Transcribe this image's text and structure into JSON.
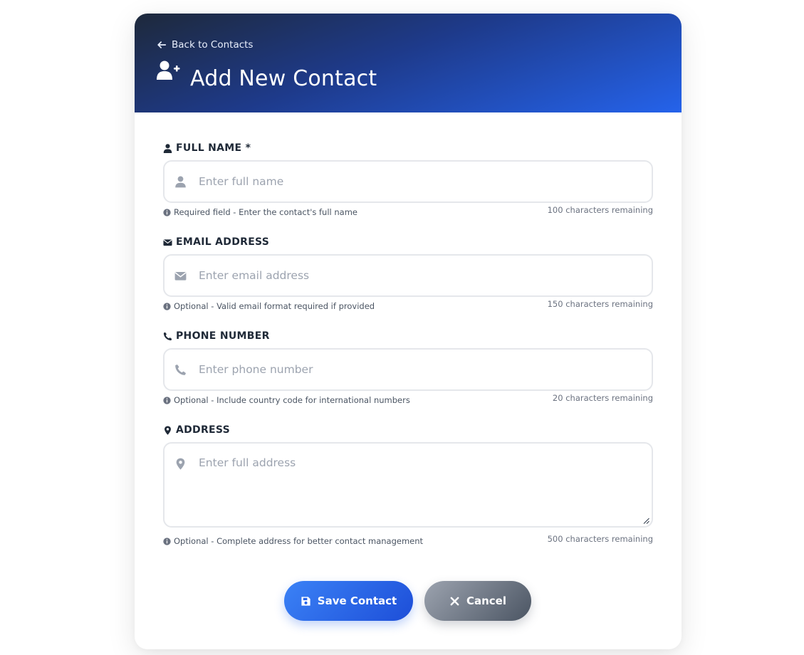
{
  "header": {
    "back_label": "Back to Contacts",
    "title": "Add New Contact"
  },
  "form": {
    "full_name": {
      "label": "FULL NAME *",
      "placeholder": "Enter full name",
      "value": "",
      "hint": "Required field - Enter the contact's full name",
      "counter": "100 characters remaining",
      "icon": "user-icon"
    },
    "email": {
      "label": "EMAIL ADDRESS",
      "placeholder": "Enter email address",
      "value": "",
      "hint": "Optional - Valid email format required if provided",
      "counter": "150 characters remaining",
      "icon": "envelope-icon"
    },
    "phone": {
      "label": "PHONE NUMBER",
      "placeholder": "Enter phone number",
      "value": "",
      "hint": "Optional - Include country code for international numbers",
      "counter": "20 characters remaining",
      "icon": "phone-icon"
    },
    "address": {
      "label": "ADDRESS",
      "placeholder": "Enter full address",
      "value": "",
      "hint": "Optional - Complete address for better contact management",
      "counter": "500 characters remaining",
      "icon": "map-marker-icon"
    }
  },
  "actions": {
    "save_label": "Save Contact",
    "cancel_label": "Cancel"
  },
  "colors": {
    "header_gradient_start": "#1e293b",
    "header_gradient_end": "#2563eb",
    "save_button": "#2563eb",
    "cancel_button": "#6b7280",
    "input_border": "#e5e7eb",
    "placeholder": "#9ca3af"
  }
}
